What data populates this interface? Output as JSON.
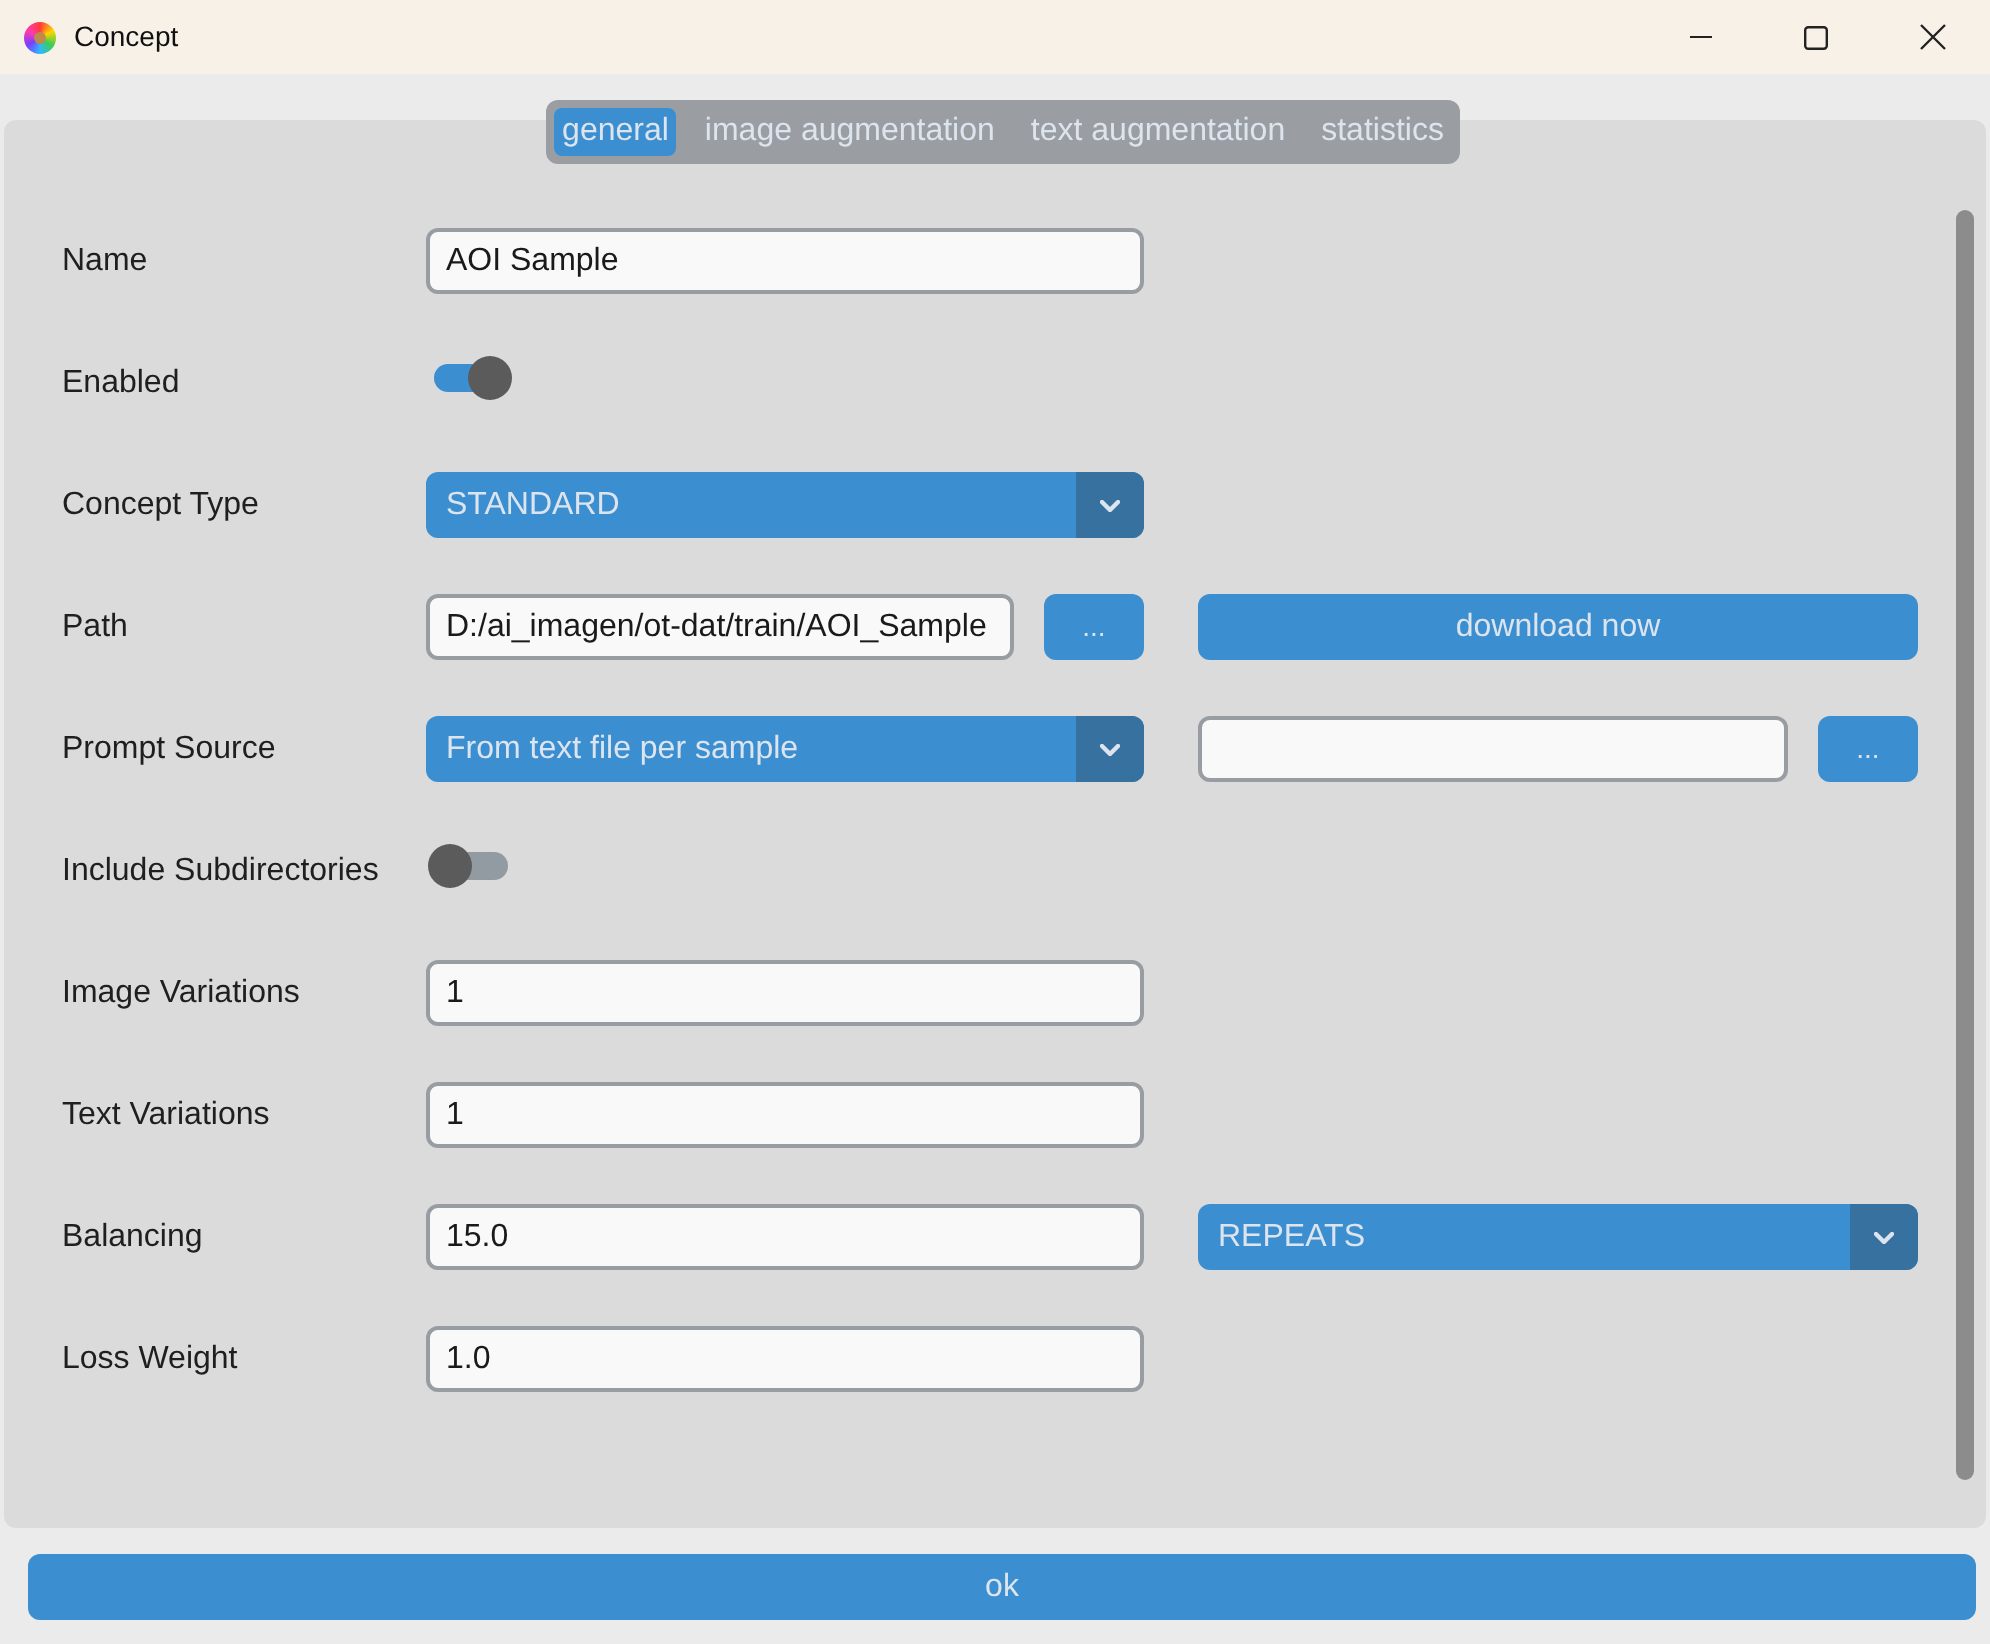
{
  "window": {
    "title": "Concept"
  },
  "tabs": [
    {
      "label": "general",
      "selected": true
    },
    {
      "label": "image augmentation",
      "selected": false
    },
    {
      "label": "text augmentation",
      "selected": false
    },
    {
      "label": "statistics",
      "selected": false
    }
  ],
  "rows": [
    {
      "label": "Name",
      "main": [
        {
          "kind": "input",
          "value": "AOI Sample"
        }
      ]
    },
    {
      "label": "Enabled",
      "main": [
        {
          "kind": "switch",
          "on": true
        }
      ]
    },
    {
      "label": "Concept Type",
      "main": [
        {
          "kind": "dropdown",
          "value": "STANDARD"
        }
      ]
    },
    {
      "label": "Path",
      "main": [
        {
          "kind": "input",
          "value": "D:/ai_imagen/ot-dat/train/AOI_Sample"
        },
        {
          "kind": "button",
          "label": "..."
        }
      ],
      "side": [
        {
          "kind": "button",
          "label": "download now"
        }
      ]
    },
    {
      "label": "Prompt Source",
      "main": [
        {
          "kind": "dropdown",
          "value": "From text file per sample"
        }
      ],
      "side": [
        {
          "kind": "input"
        },
        {
          "kind": "button",
          "label": "..."
        }
      ]
    },
    {
      "label": "Include Subdirectories",
      "main": [
        {
          "kind": "switch",
          "on": false
        }
      ]
    },
    {
      "label": "Image Variations",
      "main": [
        {
          "kind": "input",
          "value": "1"
        }
      ]
    },
    {
      "label": "Text Variations",
      "main": [
        {
          "kind": "input",
          "value": "1"
        }
      ]
    },
    {
      "label": "Balancing",
      "main": [
        {
          "kind": "input",
          "value": "15.0"
        }
      ],
      "side": [
        {
          "kind": "dropdown",
          "value": "REPEATS"
        }
      ]
    },
    {
      "label": "Loss Weight",
      "main": [
        {
          "kind": "input",
          "value": "1.0"
        }
      ]
    }
  ],
  "ok_button": {
    "label": "ok"
  }
}
